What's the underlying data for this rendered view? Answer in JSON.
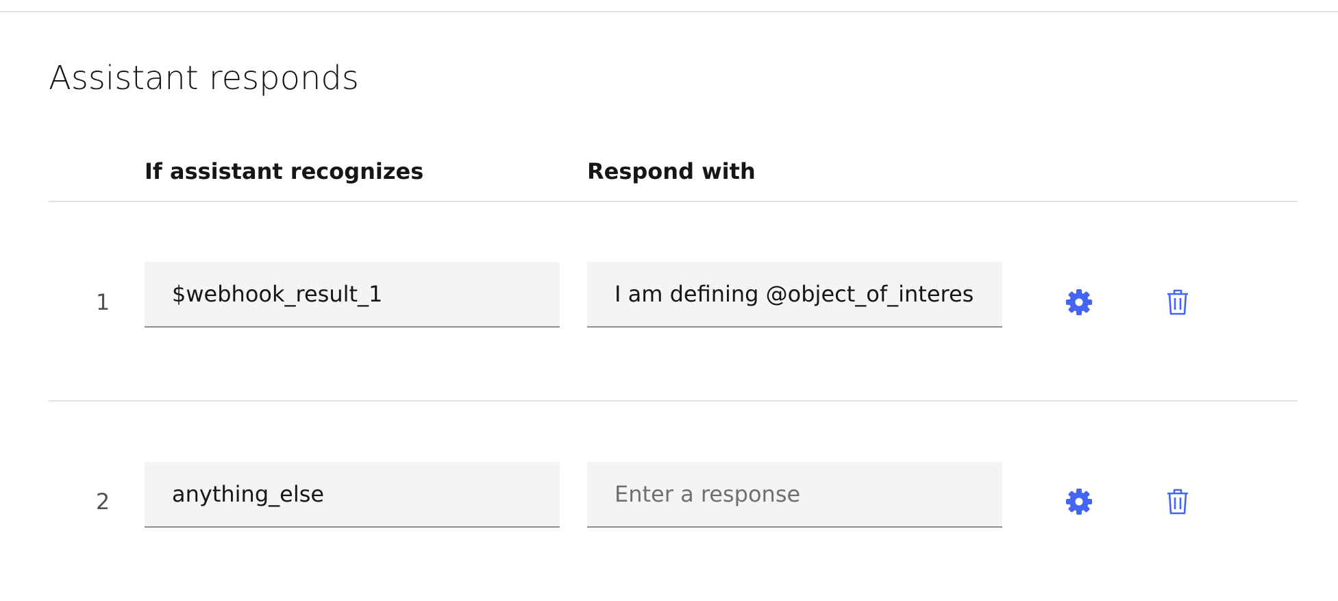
{
  "section": {
    "title": "Assistant responds"
  },
  "columns": {
    "condition_header": "If assistant recognizes",
    "response_header": "Respond with"
  },
  "rows": [
    {
      "number": "1",
      "condition": "$webhook_result_1",
      "response": "I am defining @object_of_interes",
      "response_placeholder": ""
    },
    {
      "number": "2",
      "condition": "anything_else",
      "response": "",
      "response_placeholder": "Enter a response"
    }
  ],
  "icons": {
    "settings": "gear-icon",
    "delete": "trash-icon"
  },
  "colors": {
    "accent": "#4365f2",
    "field_background": "#f4f4f4",
    "field_underline": "#8d8d8d",
    "divider": "#e0e0e0",
    "text_primary": "#161616",
    "text_muted": "#525252",
    "placeholder": "#6f6f6f"
  }
}
